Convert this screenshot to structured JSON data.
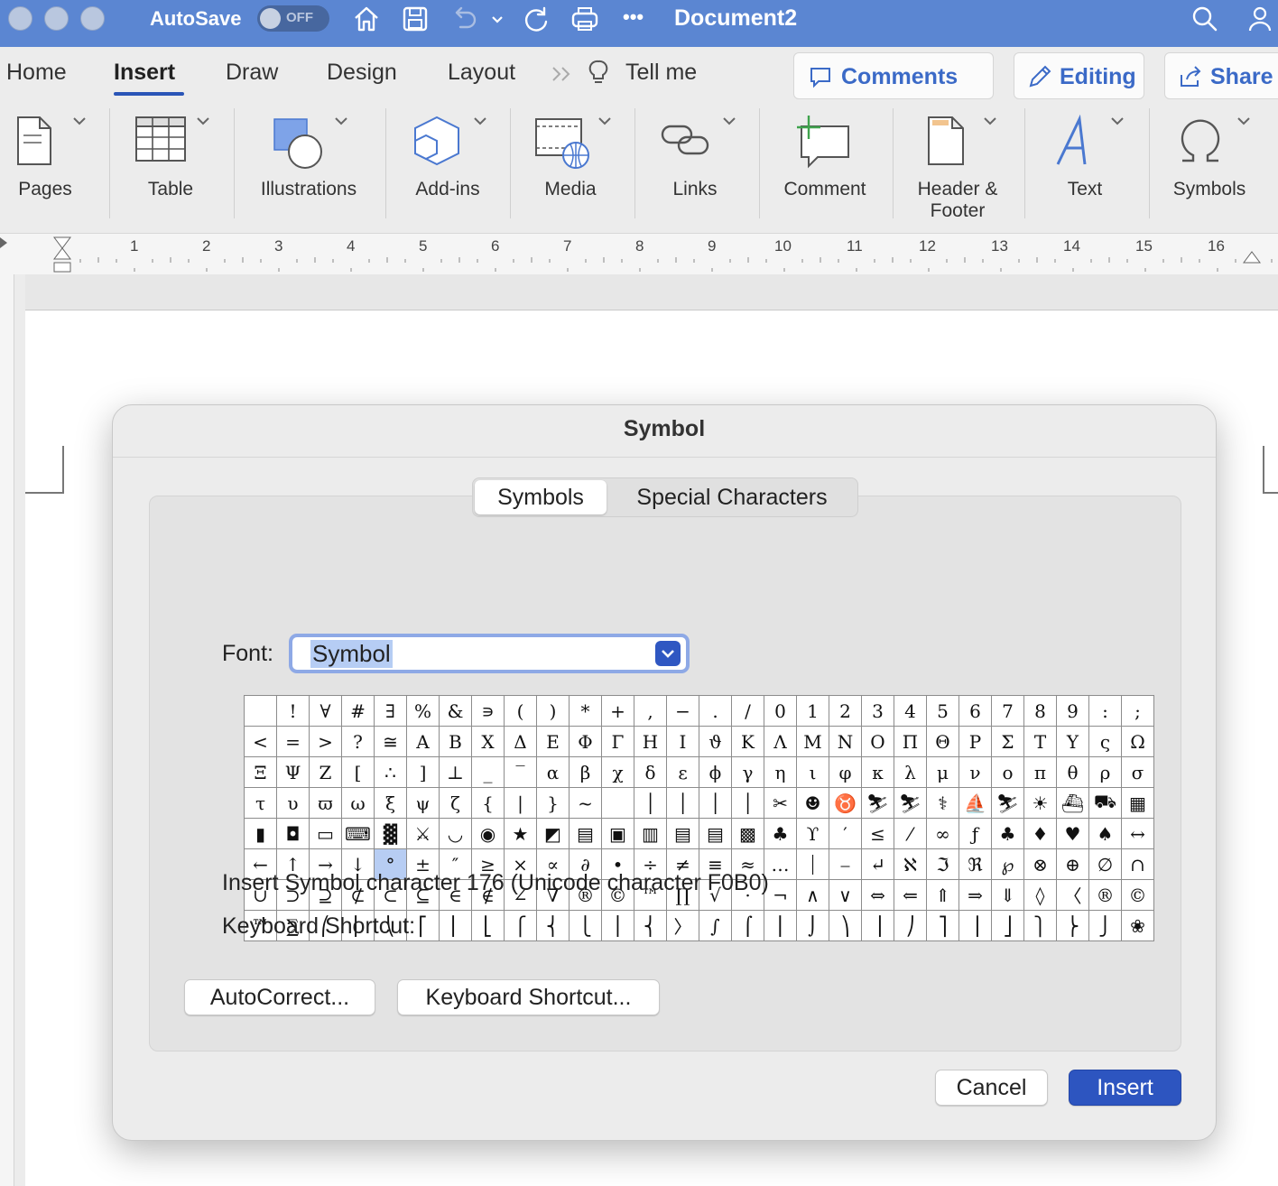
{
  "titlebar": {
    "autosave_label": "AutoSave",
    "autosave_state": "OFF",
    "document_title": "Document2",
    "more": "•••"
  },
  "tabs": [
    "Home",
    "Insert",
    "Draw",
    "Design",
    "Layout",
    "Tell me"
  ],
  "active_tab": "Insert",
  "actions": {
    "comments": "Comments",
    "editing": "Editing",
    "share": "Share"
  },
  "ribbon": {
    "pages": "Pages",
    "table": "Table",
    "illustrations": "Illustrations",
    "addins": "Add-ins",
    "media": "Media",
    "links": "Links",
    "comment": "Comment",
    "header_footer_1": "Header &",
    "header_footer_2": "Footer",
    "text": "Text",
    "symbols": "Symbols"
  },
  "ruler": [
    "1",
    "2",
    "3",
    "4",
    "5",
    "6",
    "7",
    "8",
    "9",
    "10",
    "11",
    "12",
    "13",
    "14",
    "15",
    "16"
  ],
  "dialog": {
    "title": "Symbol",
    "tab_symbols": "Symbols",
    "tab_special": "Special Characters",
    "font_label": "Font:",
    "font_value": "Symbol",
    "selected_row": 5,
    "selected_col": 4,
    "grid": [
      [
        " ",
        "!",
        "∀",
        "#",
        "∃",
        "%",
        "&",
        "∍",
        "(",
        ")",
        "*",
        "+",
        ",",
        "−",
        ".",
        "/",
        "0",
        "1",
        "2",
        "3",
        "4",
        "5",
        "6",
        "7",
        "8",
        "9",
        ":",
        ";"
      ],
      [
        "<",
        "=",
        ">",
        "?",
        "≅",
        "Α",
        "Β",
        "Χ",
        "Δ",
        "Ε",
        "Φ",
        "Γ",
        "Η",
        "Ι",
        "ϑ",
        "Κ",
        "Λ",
        "Μ",
        "Ν",
        "Ο",
        "Π",
        "Θ",
        "Ρ",
        "Σ",
        "Τ",
        "Υ",
        "ς",
        "Ω"
      ],
      [
        "Ξ",
        "Ψ",
        "Ζ",
        "[",
        "∴",
        "]",
        "⊥",
        "_",
        "‾",
        "α",
        "β",
        "χ",
        "δ",
        "ε",
        "ϕ",
        "γ",
        "η",
        "ι",
        "φ",
        "κ",
        "λ",
        "μ",
        "ν",
        "ο",
        "π",
        "θ",
        "ρ",
        "σ"
      ],
      [
        "τ",
        "υ",
        "ϖ",
        "ω",
        "ξ",
        "ψ",
        "ζ",
        "{",
        "|",
        "}",
        "~",
        " ",
        "│",
        "│",
        "│",
        "│",
        "✂",
        "☻",
        "♉",
        "⛷",
        "⛷",
        "⚕",
        "⛵",
        "⛷",
        "☀",
        "⛴",
        "⛟",
        "▦"
      ],
      [
        "▮",
        "◘",
        "▭",
        "⌨",
        "▓",
        "⚔",
        "◡",
        "◉",
        "★",
        "◩",
        "▤",
        "▣",
        "▥",
        "▤",
        "▤",
        "▩",
        "♣",
        "ϒ",
        "′",
        "≤",
        "⁄",
        "∞",
        "ƒ",
        "♣",
        "♦",
        "♥",
        "♠",
        "↔"
      ],
      [
        "←",
        "↑",
        "→",
        "↓",
        "°",
        "±",
        "″",
        "≥",
        "×",
        "∝",
        "∂",
        "•",
        "÷",
        "≠",
        "≡",
        "≈",
        "…",
        "⏐",
        "⎯",
        "↵",
        "ℵ",
        "ℑ",
        "ℜ",
        "℘",
        "⊗",
        "⊕",
        "∅",
        "∩"
      ],
      [
        "∪",
        "⊃",
        "⊇",
        "⊄",
        "⊂",
        "⊆",
        "∈",
        "∉",
        "∠",
        "∇",
        "®",
        "©",
        "™",
        "∏",
        "√",
        "⋅",
        "¬",
        "∧",
        "∨",
        "⇔",
        "⇐",
        "⇑",
        "⇒",
        "⇓",
        "◊",
        "〈",
        "®",
        "©"
      ],
      [
        "™",
        "∑",
        "⎛",
        "⎜",
        "⎝",
        "⎡",
        "⎢",
        "⎣",
        "⎧",
        "⎨",
        "⎩",
        "⎪",
        "⎨",
        "〉",
        "∫",
        "⌠",
        "⎮",
        "⌡",
        "⎞",
        "⎟",
        "⎠",
        "⎤",
        "⎥",
        "⎦",
        "⎫",
        "⎬",
        "⎭",
        "❀"
      ]
    ],
    "info_line": "Insert Symbol character 176  (Unicode character F0B0)",
    "shortcut_line": "Keyboard Shortcut:",
    "btn_autocorrect": "AutoCorrect...",
    "btn_shortcut": "Keyboard Shortcut...",
    "btn_cancel": "Cancel",
    "btn_insert": "Insert"
  }
}
